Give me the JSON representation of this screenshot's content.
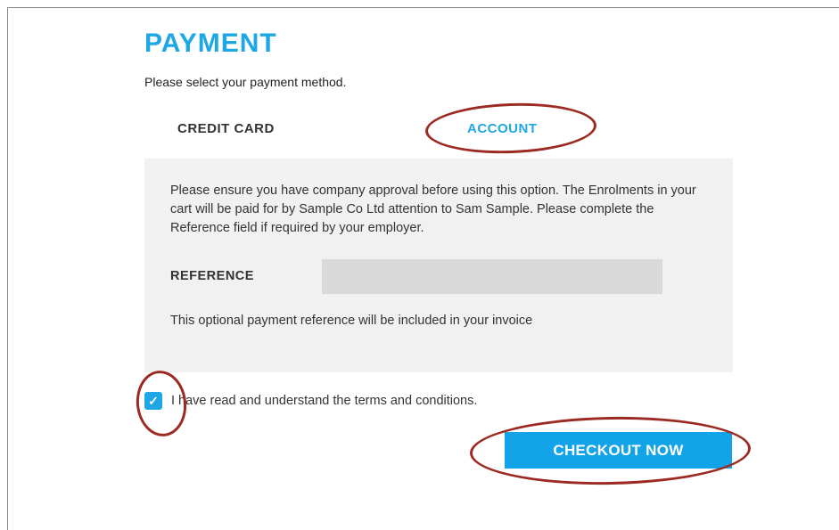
{
  "page": {
    "title": "PAYMENT",
    "subtitle": "Please select your payment method."
  },
  "tabs": [
    {
      "label": "CREDIT CARD",
      "selected": false
    },
    {
      "label": "ACCOUNT",
      "selected": true
    }
  ],
  "account_panel": {
    "notice": "Please ensure you have company approval before using this option. The Enrolments in your cart will be paid for by Sample Co Ltd attention to Sam Sample. Please complete the Reference field if required by your employer.",
    "reference_label": "REFERENCE",
    "reference_value": "",
    "reference_help": "This optional payment reference will be included in your invoice"
  },
  "terms": {
    "checked": true,
    "label": "I have read and understand the terms and conditions."
  },
  "checkout_button": "CHECKOUT NOW",
  "colors": {
    "accent": "#1ea7e4",
    "button": "#12a3e8",
    "panel_bg": "#f1f1f1",
    "annotation": "#9b2a22"
  }
}
